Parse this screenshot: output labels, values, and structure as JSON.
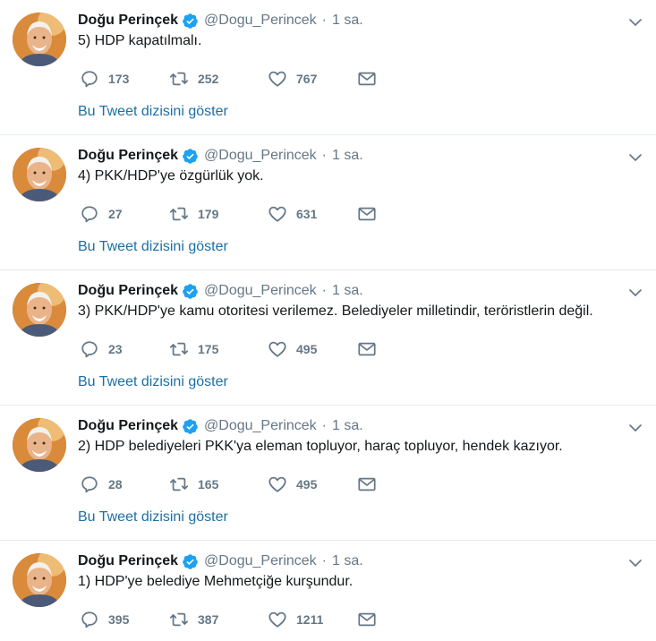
{
  "colors": {
    "name": "#14171a",
    "muted": "#657786",
    "link": "#1b6fa6",
    "verified": "#1da1f2",
    "divider": "#e6ecf0"
  },
  "icons": {
    "verified": "verified-badge-icon",
    "caret": "chevron-down-icon",
    "reply": "reply-icon",
    "retweet": "retweet-icon",
    "like": "heart-icon",
    "dm": "envelope-icon"
  },
  "tweets": [
    {
      "fullname": "Doğu Perinçek",
      "username": "@Dogu_Perincek",
      "separator": "·",
      "time": "1 sa.",
      "text": "5) HDP kapatılmalı.",
      "replies": "173",
      "retweets": "252",
      "likes": "767",
      "thread_link": "Bu Tweet dizisini göster"
    },
    {
      "fullname": "Doğu Perinçek",
      "username": "@Dogu_Perincek",
      "separator": "·",
      "time": "1 sa.",
      "text": "4) PKK/HDP'ye özgürlük yok.",
      "replies": "27",
      "retweets": "179",
      "likes": "631",
      "thread_link": "Bu Tweet dizisini göster"
    },
    {
      "fullname": "Doğu Perinçek",
      "username": "@Dogu_Perincek",
      "separator": "·",
      "time": "1 sa.",
      "text": "3) PKK/HDP'ye kamu otoritesi verilemez. Belediyeler milletindir, teröristlerin değil.",
      "replies": "23",
      "retweets": "175",
      "likes": "495",
      "thread_link": "Bu Tweet dizisini göster"
    },
    {
      "fullname": "Doğu Perinçek",
      "username": "@Dogu_Perincek",
      "separator": "·",
      "time": "1 sa.",
      "text": "2) HDP belediyeleri PKK'ya eleman topluyor, haraç topluyor, hendek kazıyor.",
      "replies": "28",
      "retweets": "165",
      "likes": "495",
      "thread_link": "Bu Tweet dizisini göster"
    },
    {
      "fullname": "Doğu Perinçek",
      "username": "@Dogu_Perincek",
      "separator": "·",
      "time": "1 sa.",
      "text": "1) HDP'ye belediye Mehmetçiğe kurşundur.",
      "replies": "395",
      "retweets": "387",
      "likes": "1211"
    }
  ]
}
